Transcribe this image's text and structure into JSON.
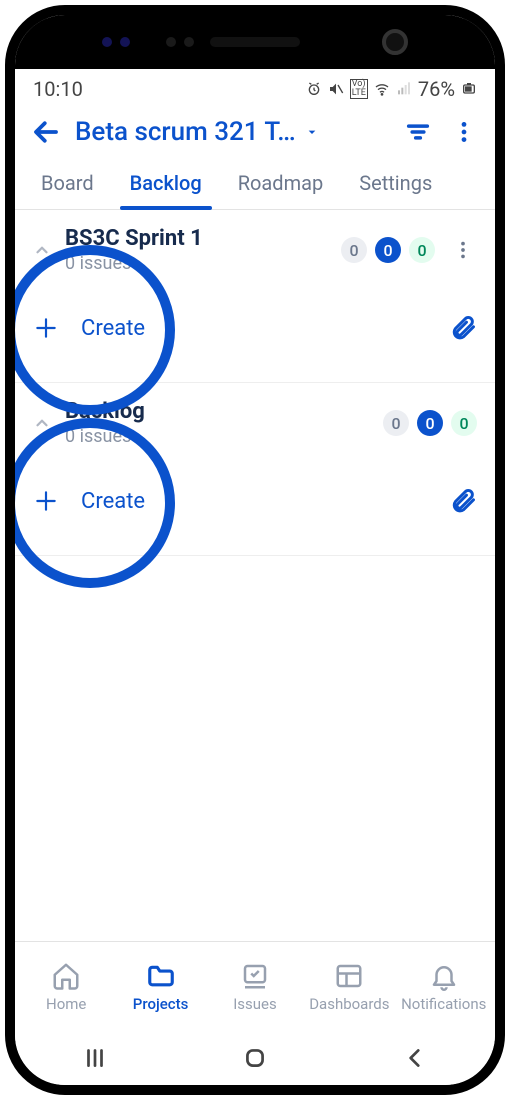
{
  "status": {
    "time": "10:10",
    "battery_pct": "76%"
  },
  "header": {
    "title": "Beta scrum 321 T…"
  },
  "tabs": [
    {
      "label": "Board"
    },
    {
      "label": "Backlog",
      "active": true
    },
    {
      "label": "Roadmap"
    },
    {
      "label": "Settings"
    }
  ],
  "sections": [
    {
      "title": "BS3C Sprint 1",
      "subtitle": "0 issues",
      "badges": {
        "grey": "0",
        "blue": "0",
        "green": "0"
      },
      "create_label": "Create",
      "show_kebab": true
    },
    {
      "title": "Backlog",
      "subtitle": "0 issues",
      "badges": {
        "grey": "0",
        "blue": "0",
        "green": "0"
      },
      "create_label": "Create",
      "show_kebab": false
    }
  ],
  "bottomnav": [
    {
      "label": "Home"
    },
    {
      "label": "Projects",
      "active": true
    },
    {
      "label": "Issues"
    },
    {
      "label": "Dashboards"
    },
    {
      "label": "Notifications"
    }
  ]
}
